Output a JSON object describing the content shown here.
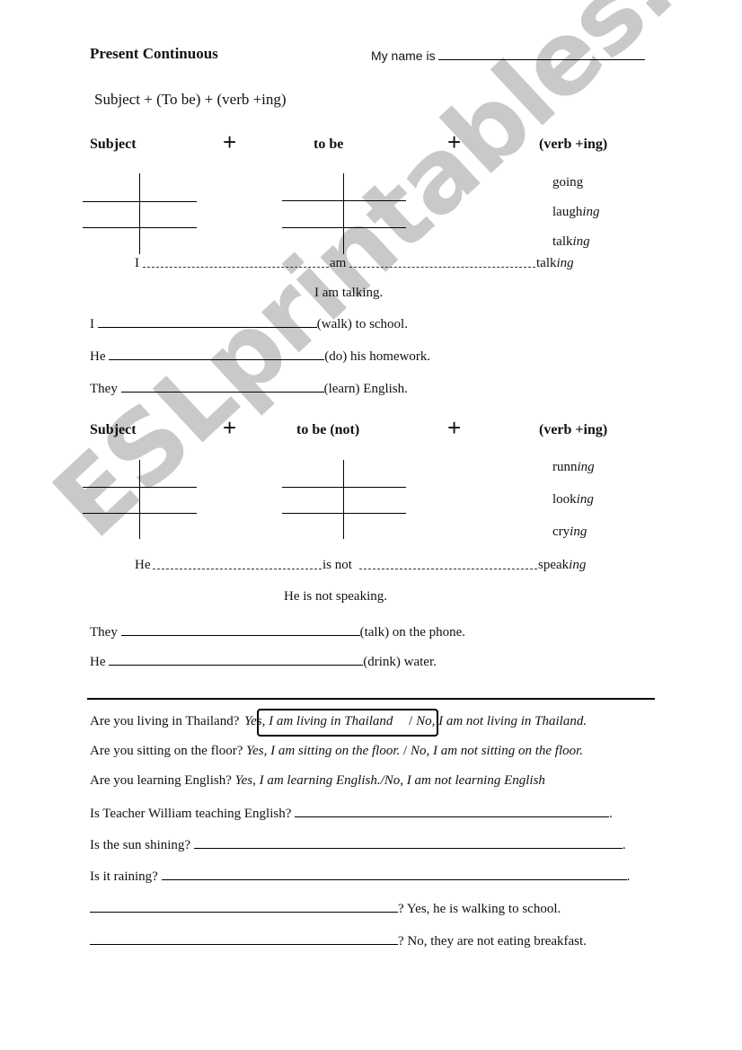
{
  "header": {
    "title": "Present Continuous",
    "name_label": "My name is"
  },
  "formula": "Subject + (To be) + (verb +ing)",
  "section1": {
    "col_subject": "Subject",
    "plus": "+",
    "col_tobe": "to be",
    "col_verb": "(verb +ing)",
    "verbs": [
      {
        "stem": "going",
        "suffix": ""
      },
      {
        "stem": "laugh",
        "suffix": "ing"
      },
      {
        "stem": "talk",
        "suffix": "ing"
      }
    ],
    "chain": {
      "subject": "I",
      "tobe": "am",
      "verb_stem": "talk",
      "verb_suffix": "ing"
    },
    "example": "I am talking.",
    "exercises": [
      {
        "subject": "I",
        "hint": "(walk) to school."
      },
      {
        "subject": "He",
        "hint": "(do) his homework."
      },
      {
        "subject": "They",
        "hint": "(learn) English."
      }
    ]
  },
  "section2": {
    "col_subject": "Subject",
    "plus": "+",
    "col_tobe": "to be (not)",
    "col_verb": "(verb +ing)",
    "verbs": [
      {
        "stem": "runn",
        "suffix": "ing"
      },
      {
        "stem": "look",
        "suffix": "ing"
      },
      {
        "stem": "cry",
        "suffix": "ing"
      }
    ],
    "chain": {
      "subject": "He",
      "tobe": "is not",
      "verb_stem": "speak",
      "verb_suffix": "ing"
    },
    "example": "He is not speaking.",
    "exercises": [
      {
        "subject": "They",
        "hint": "(talk) on the phone."
      },
      {
        "subject": "He",
        "hint": "(drink) water."
      }
    ]
  },
  "questions": {
    "examples": [
      {
        "q": "Are you living in Thailand?",
        "yes": "Yes, I am living in Thailand",
        "sep": "/",
        "no": "No, I am not living in Thailand."
      },
      {
        "q": "Are you sitting on the floor?",
        "yes": "Yes, I am sitting on the floor.",
        "sep": "/",
        "no": "No, I am not sitting on the floor."
      },
      {
        "q": "Are you learning English?",
        "yes": "Yes, I am learning English.",
        "sep": "/",
        "no": "No, I am not learning English"
      }
    ],
    "open": [
      {
        "q": "Is Teacher William teaching English?",
        "end": "."
      },
      {
        "q": "Is the sun shining?",
        "end": "."
      },
      {
        "q": "Is it raining?",
        "end": "."
      }
    ],
    "reverse": [
      {
        "a": "? Yes, he is walking to school."
      },
      {
        "a": "? No, they are not eating breakfast."
      }
    ]
  },
  "watermark": "ESLprintables.com"
}
